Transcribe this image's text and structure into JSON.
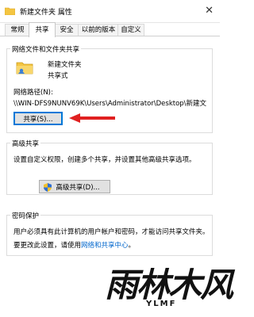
{
  "window": {
    "title": "新建文件夹 属性",
    "close_glyph": "✕"
  },
  "tabs": [
    {
      "label": "常规",
      "active": false
    },
    {
      "label": "共享",
      "active": true
    },
    {
      "label": "安全",
      "active": false
    },
    {
      "label": "以前的版本",
      "active": false
    },
    {
      "label": "自定义",
      "active": false
    }
  ],
  "network_share": {
    "group_title": "网络文件和文件夹共享",
    "folder_name": "新建文件夹",
    "share_status": "共享式",
    "path_label": "网络路径(N):",
    "path_value": "\\\\WIN-DFS9NUNV69K\\Users\\Administrator\\Desktop\\新建文",
    "share_button": "共享(S)..."
  },
  "advanced_share": {
    "group_title": "高级共享",
    "description": "设置自定义权限，创建多个共享，并设置其他高级共享选项。",
    "button": "高级共享(D)..."
  },
  "password_protect": {
    "group_title": "密码保护",
    "line1": "用户必须具有此计算机的用户帐户和密码，才能访问共享文件夹。",
    "line2_prefix": "要更改此设置，请使用",
    "link": "网络和共享中心",
    "line2_suffix": "。"
  },
  "watermark": {
    "main": "雨林木风",
    "sub": "YLMF"
  },
  "colors": {
    "accent": "#0078d7",
    "arrow": "#e02020",
    "folder": "#f4c542"
  }
}
